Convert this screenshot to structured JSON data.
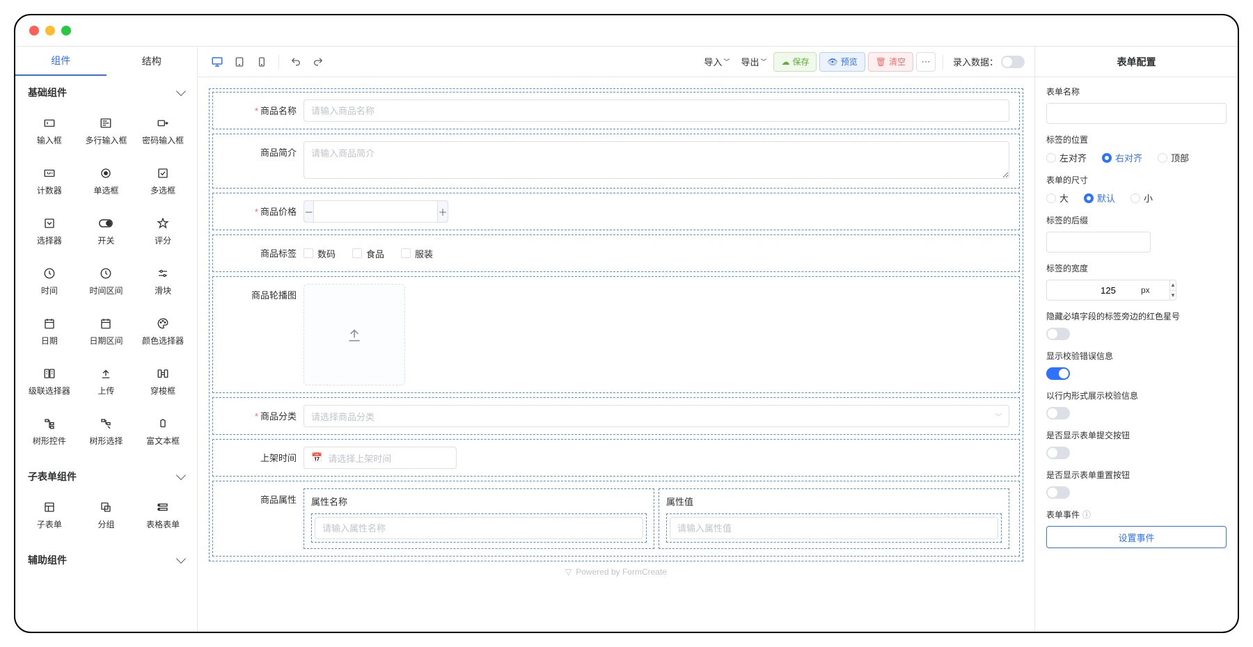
{
  "left": {
    "tabs": {
      "components": "组件",
      "structure": "结构"
    },
    "groups": {
      "basic": "基础组件",
      "subform": "子表单组件",
      "aux": "辅助组件"
    },
    "basic_items": [
      {
        "name": "input",
        "label": "输入框"
      },
      {
        "name": "textarea",
        "label": "多行输入框"
      },
      {
        "name": "password",
        "label": "密码输入框"
      },
      {
        "name": "counter",
        "label": "计数器"
      },
      {
        "name": "radio",
        "label": "单选框"
      },
      {
        "name": "checkbox",
        "label": "多选框"
      },
      {
        "name": "select",
        "label": "选择器"
      },
      {
        "name": "switch",
        "label": "开关"
      },
      {
        "name": "rate",
        "label": "评分"
      },
      {
        "name": "time",
        "label": "时间"
      },
      {
        "name": "time-range",
        "label": "时间区间"
      },
      {
        "name": "slider",
        "label": "滑块"
      },
      {
        "name": "date",
        "label": "日期"
      },
      {
        "name": "date-range",
        "label": "日期区间"
      },
      {
        "name": "color",
        "label": "颜色选择器"
      },
      {
        "name": "cascader",
        "label": "级联选择器"
      },
      {
        "name": "upload",
        "label": "上传"
      },
      {
        "name": "transfer",
        "label": "穿梭框"
      },
      {
        "name": "tree",
        "label": "树形控件"
      },
      {
        "name": "tree-select",
        "label": "树形选择"
      },
      {
        "name": "rich-text",
        "label": "富文本框"
      }
    ],
    "subform_items": [
      {
        "name": "subform",
        "label": "子表单"
      },
      {
        "name": "group",
        "label": "分组"
      },
      {
        "name": "table-form",
        "label": "表格表单"
      }
    ]
  },
  "toolbar": {
    "import": "导入",
    "export": "导出",
    "save": "保存",
    "preview": "预览",
    "clear": "清空",
    "record": "录入数据："
  },
  "form": {
    "name": {
      "label": "商品名称",
      "placeholder": "请输入商品名称"
    },
    "brief": {
      "label": "商品简介",
      "placeholder": "请输入商品简介"
    },
    "price": {
      "label": "商品价格",
      "value": ""
    },
    "tags": {
      "label": "商品标签",
      "options": [
        "数码",
        "食品",
        "服装"
      ]
    },
    "carousel": {
      "label": "商品轮播图"
    },
    "category": {
      "label": "商品分类",
      "placeholder": "请选择商品分类"
    },
    "shelf_time": {
      "label": "上架时间",
      "placeholder": "请选择上架时间"
    },
    "attrs": {
      "label": "商品属性",
      "col_name": {
        "label": "属性名称",
        "placeholder": "请输入属性名称"
      },
      "col_value": {
        "label": "属性值",
        "placeholder": "请输入属性值"
      }
    },
    "powered": "Powered by FormCreate"
  },
  "right": {
    "title": "表单配置",
    "form_name": "表单名称",
    "label_pos": {
      "title": "标签的位置",
      "left": "左对齐",
      "right": "右对齐",
      "top": "顶部"
    },
    "size": {
      "title": "表单的尺寸",
      "large": "大",
      "default": "默认",
      "small": "小"
    },
    "suffix": "标签的后缀",
    "label_width": {
      "title": "标签的宽度",
      "value": "125",
      "unit": "px"
    },
    "hide_star": "隐藏必填字段的标签旁边的红色星号",
    "show_error": "显示校验错误信息",
    "inline_valid": "以行内形式展示校验信息",
    "show_submit": "是否显示表单提交按钮",
    "show_reset": "是否显示表单重置按钮",
    "events": "表单事件",
    "set_event": "设置事件"
  }
}
